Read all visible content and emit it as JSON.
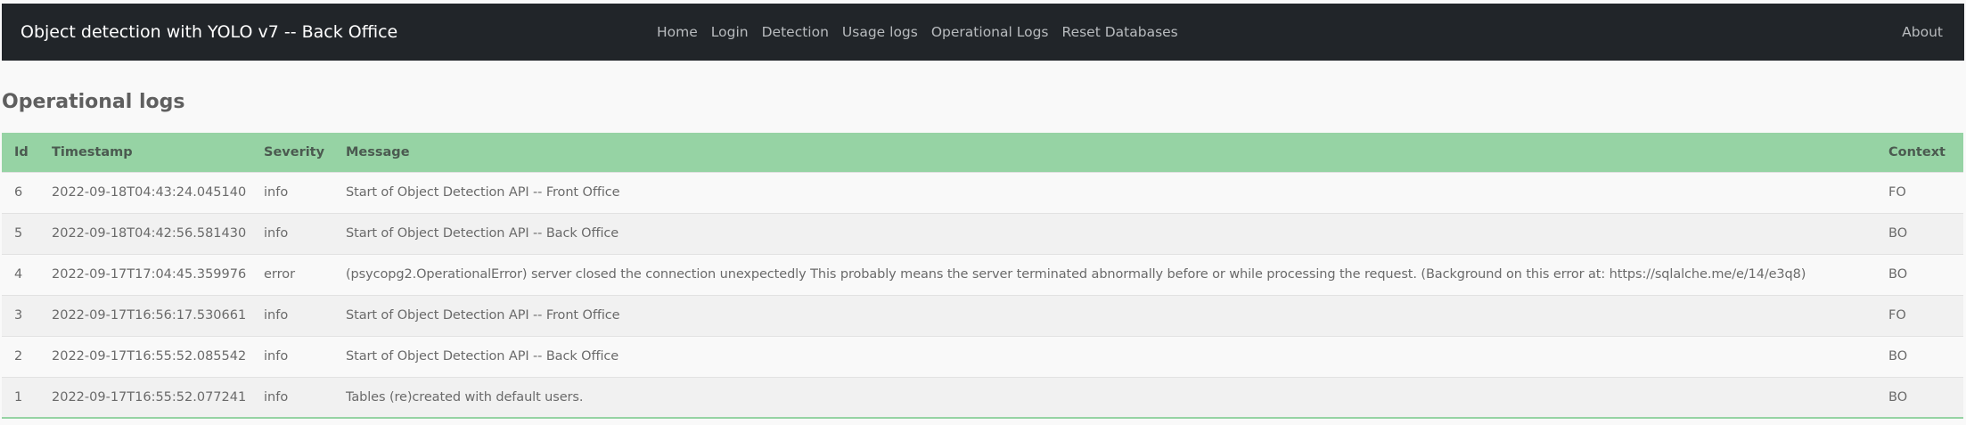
{
  "navbar": {
    "brand": "Object detection with YOLO v7 -- Back Office",
    "links": [
      "Home",
      "Login",
      "Detection",
      "Usage logs",
      "Operational Logs",
      "Reset Databases"
    ],
    "about": "About",
    "background": "#212529"
  },
  "page": {
    "title": "Operational logs"
  },
  "table": {
    "header_color": "#96d3a4",
    "columns": [
      "Id",
      "Timestamp",
      "Severity",
      "Message",
      "Context"
    ],
    "rows": [
      {
        "id": "6",
        "timestamp": "2022-09-18T04:43:24.045140",
        "severity": "info",
        "message": "Start of Object Detection API -- Front Office",
        "context": "FO"
      },
      {
        "id": "5",
        "timestamp": "2022-09-18T04:42:56.581430",
        "severity": "info",
        "message": "Start of Object Detection API -- Back Office",
        "context": "BO"
      },
      {
        "id": "4",
        "timestamp": "2022-09-17T17:04:45.359976",
        "severity": "error",
        "message": "(psycopg2.OperationalError) server closed the connection unexpectedly This probably means the server terminated abnormally before or while processing the request. (Background on this error at: https://sqlalche.me/e/14/e3q8)",
        "context": "BO"
      },
      {
        "id": "3",
        "timestamp": "2022-09-17T16:56:17.530661",
        "severity": "info",
        "message": "Start of Object Detection API -- Front Office",
        "context": "FO"
      },
      {
        "id": "2",
        "timestamp": "2022-09-17T16:55:52.085542",
        "severity": "info",
        "message": "Start of Object Detection API -- Back Office",
        "context": "BO"
      },
      {
        "id": "1",
        "timestamp": "2022-09-17T16:55:52.077241",
        "severity": "info",
        "message": "Tables (re)created with default users.",
        "context": "BO"
      }
    ]
  }
}
